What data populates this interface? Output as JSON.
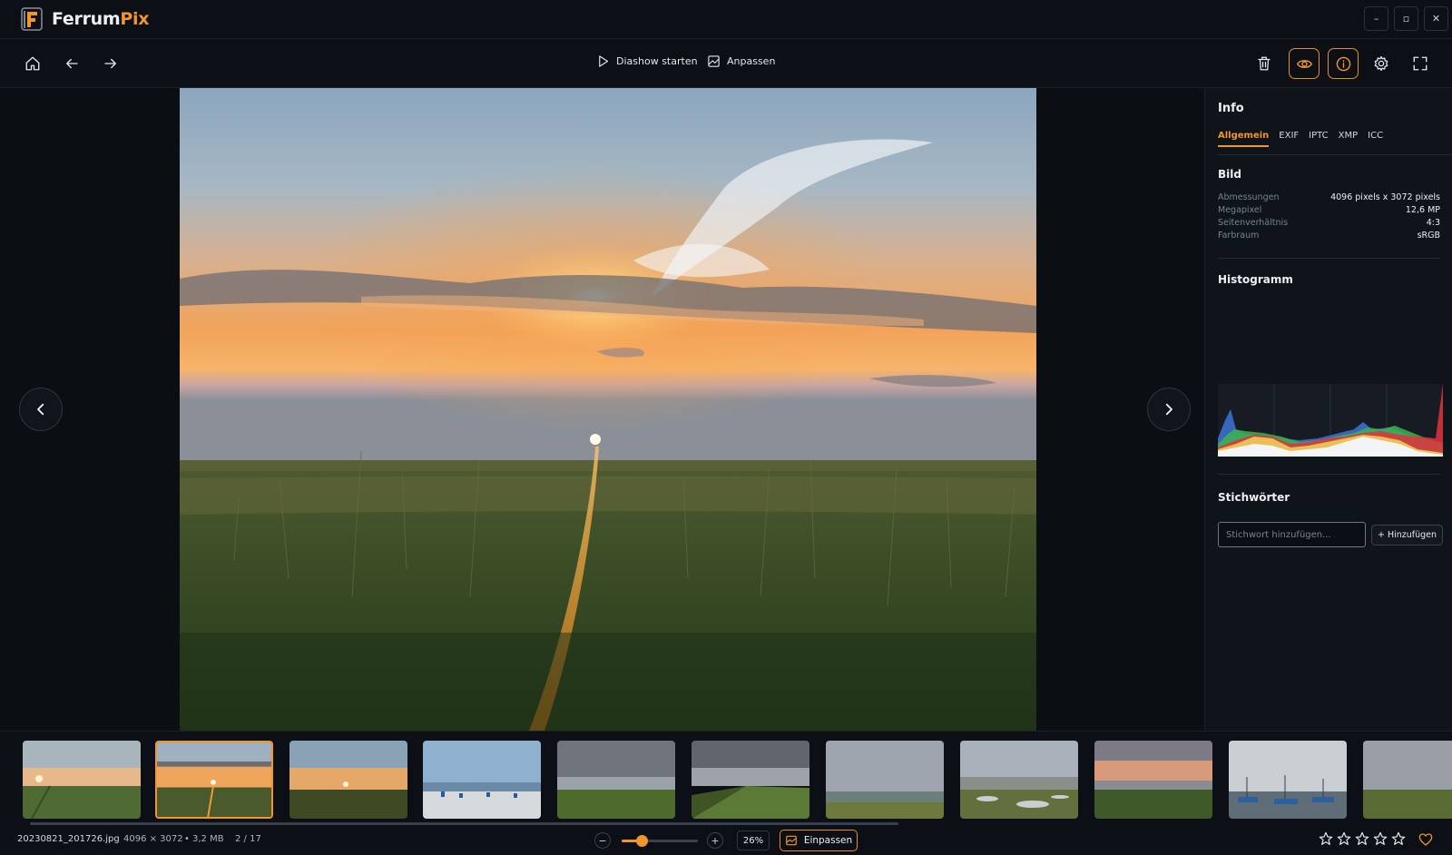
{
  "app": {
    "name_part1": "Ferrum",
    "name_part2": "Pix"
  },
  "window_controls": {
    "minimize": "–",
    "maximize": "▫",
    "close": "✕"
  },
  "toolbar": {
    "slideshow_label": "Diashow starten",
    "adjust_label": "Anpassen"
  },
  "info_panel": {
    "title": "Info",
    "tabs": [
      "Allgemein",
      "EXIF",
      "IPTC",
      "XMP",
      "ICC"
    ],
    "active_tab": "Allgemein",
    "image_section": {
      "title": "Bild",
      "rows": [
        {
          "key": "Abmessungen",
          "value": "4096 pixels x 3072 pixels"
        },
        {
          "key": "Megapixel",
          "value": "12,6 MP"
        },
        {
          "key": "Seitenverhältnis",
          "value": "4:3"
        },
        {
          "key": "Farbraum",
          "value": "sRGB"
        }
      ]
    },
    "histogram_title": "Histogramm",
    "keywords": {
      "title": "Stichwörter",
      "placeholder": "Stichwort hinzufügen...",
      "add_button": "+ Hinzufügen"
    }
  },
  "filmstrip": {
    "thumbnail_count": 11,
    "active_index": 1
  },
  "status": {
    "filename": "20230821_201726.jpg",
    "dimensions": "4096 × 3072",
    "separator": "•",
    "filesize": "3,2 MB",
    "position": "2 / 17",
    "zoom_minus": "−",
    "zoom_plus": "+",
    "zoom_level": "26%",
    "zoom_fraction": 0.26,
    "fit_label": "Einpassen",
    "rating": 0,
    "rating_max": 5,
    "favorite": false
  },
  "colors": {
    "accent": "#f0962a",
    "background": "#0b0e13",
    "panel": "#0f131a"
  }
}
